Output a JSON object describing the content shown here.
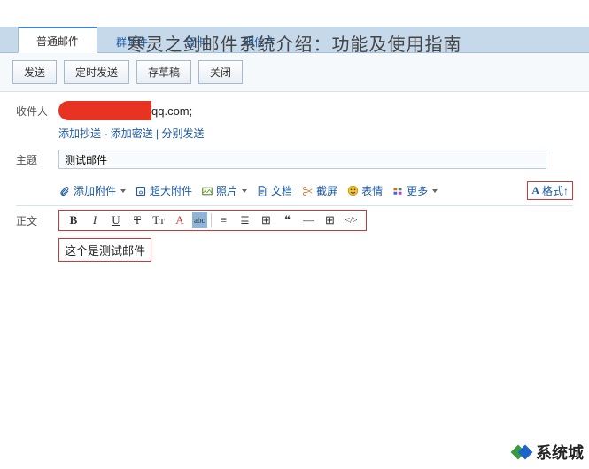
{
  "overlay_title": "寒灵之剑邮件系统介绍：功能及使用指南",
  "tabs": {
    "normal": "普通邮件",
    "group": "群邮件",
    "greeting": "贺卡",
    "postcard": "明信片"
  },
  "actions": {
    "send": "发送",
    "schedule": "定时发送",
    "draft": "存草稿",
    "close": "关闭"
  },
  "labels": {
    "recipient": "收件人",
    "subject": "主题",
    "body": "正文"
  },
  "recipient": {
    "domain": "qq.com;"
  },
  "cc": {
    "add_cc": "添加抄送",
    "sep1": " - ",
    "add_bcc": "添加密送",
    "sep2": " | ",
    "split": "分别发送"
  },
  "subject_value": "测试邮件",
  "attach": {
    "add": "添加附件",
    "big": "超大附件",
    "photo": "照片",
    "doc": "文档",
    "screenshot": "截屏",
    "emoji": "表情",
    "more": "更多",
    "format": "格式↑"
  },
  "fmt": {
    "bold": "B",
    "italic": "I",
    "underline": "U",
    "strike": "T",
    "size": "Tт",
    "color": "A",
    "bg": "abc",
    "align": "≡",
    "list": "≣",
    "indent": "⊞",
    "quote": "❝",
    "hr": "—",
    "table": "⊞",
    "code": "</>"
  },
  "body_text": "这个是测试邮件",
  "watermark": "系统城"
}
